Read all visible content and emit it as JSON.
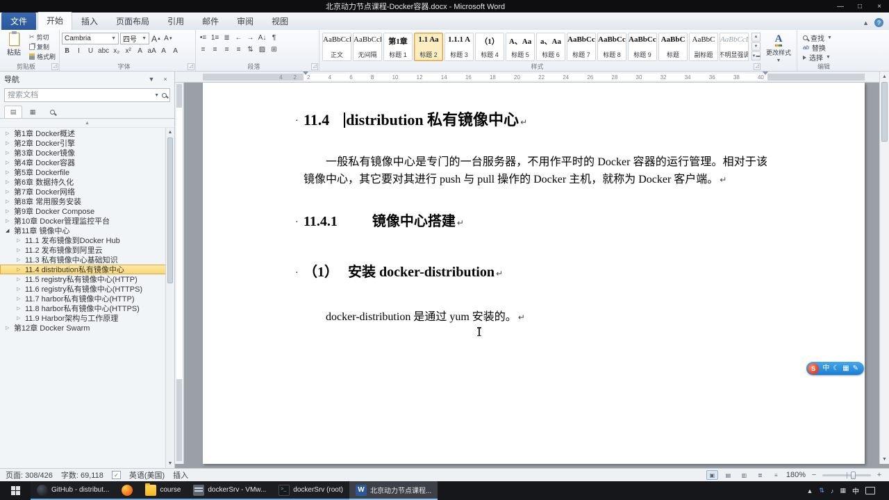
{
  "titlebar": {
    "title": "北京动力节点课程-Docker容器.docx - Microsoft Word"
  },
  "ribbon": {
    "file_tab": "文件",
    "tabs": [
      {
        "label": "开始",
        "active": true
      },
      {
        "label": "插入"
      },
      {
        "label": "页面布局"
      },
      {
        "label": "引用"
      },
      {
        "label": "邮件"
      },
      {
        "label": "审阅"
      },
      {
        "label": "视图"
      }
    ],
    "clipboard": {
      "label": "剪贴板",
      "paste": "粘贴",
      "cut": "剪切",
      "copy": "复制",
      "format_painter": "格式刷"
    },
    "font": {
      "label": "字体",
      "family": "Cambria",
      "size": "四号",
      "buttons": [
        "B",
        "I",
        "U",
        "abc",
        "x₂",
        "x²",
        "A",
        "aA",
        "A",
        "A"
      ]
    },
    "paragraph": {
      "label": "段落",
      "row1": [
        "•≡",
        "1≡",
        "≣",
        "←",
        "→",
        "A↓",
        "¶"
      ],
      "row2": [
        "≡",
        "≡",
        "≡",
        "≡",
        "⇅",
        "▨",
        "⊞"
      ]
    },
    "styles": {
      "label": "样式",
      "change_label": "更改样式",
      "gallery": [
        {
          "preview": "AaBbCcDd",
          "name": "正文"
        },
        {
          "preview": "AaBbCcDd",
          "name": "无间隔"
        },
        {
          "preview": "第1章",
          "name": "标题 1",
          "bold": true
        },
        {
          "preview": "1.1 Aa",
          "name": "标题 2",
          "bold": true,
          "selected": true
        },
        {
          "preview": "1.1.1 A",
          "name": "标题 3",
          "bold": true
        },
        {
          "preview": "（1）",
          "name": "标题 4",
          "bold": true
        },
        {
          "preview": "A、Aa",
          "name": "标题 5",
          "bold": true
        },
        {
          "preview": "a、Aa",
          "name": "标题 6",
          "bold": true
        },
        {
          "preview": "AaBbCcD",
          "name": "标题 7",
          "bold": true
        },
        {
          "preview": "AaBbCcI",
          "name": "标题 8",
          "bold": true
        },
        {
          "preview": "AaBbCcDi",
          "name": "标题 9",
          "bold": true
        },
        {
          "preview": "AaBbC",
          "name": "标题",
          "bold": true
        },
        {
          "preview": "AaBbC",
          "name": "副标题"
        },
        {
          "preview": "AaBbCcDd",
          "name": "不明显强调",
          "muted": true
        }
      ]
    },
    "editing": {
      "label": "编辑",
      "find": "查找",
      "replace": "替换",
      "select": "选择"
    }
  },
  "navpane": {
    "title": "导航",
    "search_placeholder": "搜索文档",
    "items": [
      {
        "arrow": "▷",
        "label": "第1章 Docker概述"
      },
      {
        "arrow": "▷",
        "label": "第2章 Docker引擎"
      },
      {
        "arrow": "▷",
        "label": "第3章 Docker镜像"
      },
      {
        "arrow": "▷",
        "label": "第4章 Docker容器"
      },
      {
        "arrow": "▷",
        "label": "第5章 Dockerfile"
      },
      {
        "arrow": "▷",
        "label": "第6章 数据持久化"
      },
      {
        "arrow": "▷",
        "label": "第7章 Docker网络"
      },
      {
        "arrow": "▷",
        "label": "第8章 常用服务安装"
      },
      {
        "arrow": "▷",
        "label": "第9章 Docker Compose"
      },
      {
        "arrow": "▷",
        "label": "第10章 Docker管理监控平台"
      },
      {
        "arrow": "◢",
        "label": "第11章 镜像中心",
        "expanded": true
      },
      {
        "arrow": "▷",
        "label": "11.1 发布镜像到Docker Hub",
        "level": 1
      },
      {
        "arrow": "▷",
        "label": "11.2 发布镜像到阿里云",
        "level": 1
      },
      {
        "arrow": "▷",
        "label": "11.3 私有镜像中心基础知识",
        "level": 1
      },
      {
        "arrow": "▷",
        "label": "11.4 distribution私有镜像中心",
        "level": 1,
        "selected": true
      },
      {
        "arrow": "▷",
        "label": "11.5 registry私有镜像中心(HTTP)",
        "level": 1
      },
      {
        "arrow": "▷",
        "label": "11.6 registry私有镜像中心(HTTPS)",
        "level": 1
      },
      {
        "arrow": "▷",
        "label": "11.7 harbor私有镜像中心(HTTP)",
        "level": 1
      },
      {
        "arrow": "▷",
        "label": "11.8 harbor私有镜像中心(HTTPS)",
        "level": 1
      },
      {
        "arrow": "▷",
        "label": "11.9 Harbor架构与工作原理",
        "level": 1
      },
      {
        "arrow": "▷",
        "label": "第12章 Docker Swarm"
      }
    ]
  },
  "ruler": {
    "margin_numbers": [
      "4",
      "2"
    ],
    "numbers": [
      "2",
      "4",
      "6",
      "8",
      "10",
      "12",
      "14",
      "16",
      "18",
      "20",
      "22",
      "24",
      "26",
      "28",
      "30",
      "32",
      "34",
      "36",
      "38",
      "40"
    ]
  },
  "doc": {
    "bullet": "·",
    "h1_num": "11.4",
    "h1_text": "distribution 私有镜像中心",
    "para1": "一般私有镜像中心是专门的一台服务器，不用作平时的 Docker 容器的运行管理。相对于该镜像中心，其它要对其进行 push 与 pull 操作的 Docker 主机，就称为 Docker 客户端。",
    "h2_num": "11.4.1",
    "h2_text": "镜像中心搭建",
    "h3_num": "（1）",
    "h3_text": "安装 docker-distribution",
    "para2": "docker-distribution 是通过 yum 安装的。",
    "pmark": "↵"
  },
  "ime": {
    "logo": "S",
    "icons": [
      "中",
      "☾",
      "▦",
      "✎"
    ]
  },
  "statusbar": {
    "page": "页面: 308/426",
    "words": "字数: 69,118",
    "lang": "英语(美国)",
    "mode": "插入",
    "zoom": "180%"
  },
  "taskbar": {
    "tasks": [
      {
        "icon": "globe",
        "label": "GitHub - distribut..."
      },
      {
        "icon": "firefox",
        "label": ""
      },
      {
        "icon": "folder",
        "label": "course"
      },
      {
        "icon": "vmware",
        "label": "dockerSrv - VMw..."
      },
      {
        "icon": "terminal",
        "label": "dockerSrv (root)"
      },
      {
        "icon": "word",
        "label": "北京动力节点课程...",
        "active": true
      }
    ],
    "tray_input": "中"
  }
}
